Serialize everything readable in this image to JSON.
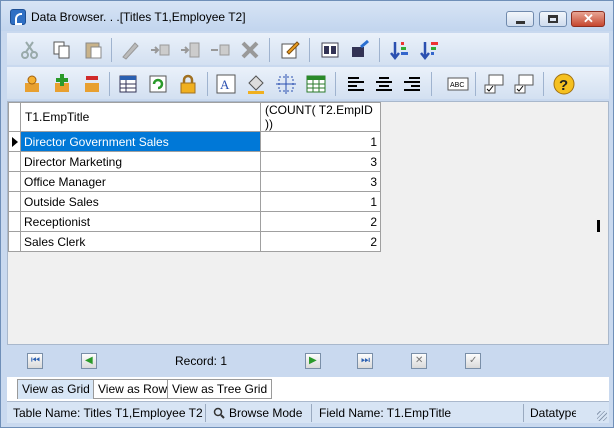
{
  "window": {
    "title": "Data Browser. . .[Titles T1,Employee T2]"
  },
  "toolbar1_icons": [
    "cut-icon",
    "copy-icon",
    "paste-icon",
    "edit-icon",
    "insert-row-icon",
    "append-row-icon",
    "delete-row-icon",
    "delete-icon",
    "edit-form-icon",
    "find-icon",
    "find-next-icon",
    "sort-asc-icon",
    "sort-desc-icon"
  ],
  "toolbar2_icons": [
    "filter-icon",
    "add-filter-icon",
    "remove-filter-icon",
    "grid-props-icon",
    "refresh-icon",
    "lock-icon",
    "font-icon",
    "fill-color-icon",
    "align-grid-icon",
    "table-color-icon",
    "align-left-icon",
    "align-center-icon",
    "align-right-icon",
    "spellcheck-icon",
    "comment-icon",
    "comment-check-icon",
    "help-icon"
  ],
  "grid": {
    "columns": [
      "T1.EmpTitle",
      "(COUNT( T2.EmpID ))"
    ],
    "rows": [
      {
        "title": "Director Government Sales",
        "count": "1"
      },
      {
        "title": "Director Marketing",
        "count": "3"
      },
      {
        "title": "Office Manager",
        "count": "3"
      },
      {
        "title": "Outside Sales",
        "count": "1"
      },
      {
        "title": "Receptionist",
        "count": "2"
      },
      {
        "title": "Sales Clerk",
        "count": "2"
      }
    ]
  },
  "nav": {
    "record": "Record: 1"
  },
  "tabs": [
    "View as Grid",
    "View as Row",
    "View as Tree Grid"
  ],
  "status": {
    "table": "Table Name: Titles T1,Employee T2",
    "mode": "Browse Mode",
    "field": "Field Name: T1.EmpTitle",
    "datatype": "Datatype"
  },
  "colors": {
    "selection": "#0078d7",
    "title_bg": "#c9d9ef"
  }
}
